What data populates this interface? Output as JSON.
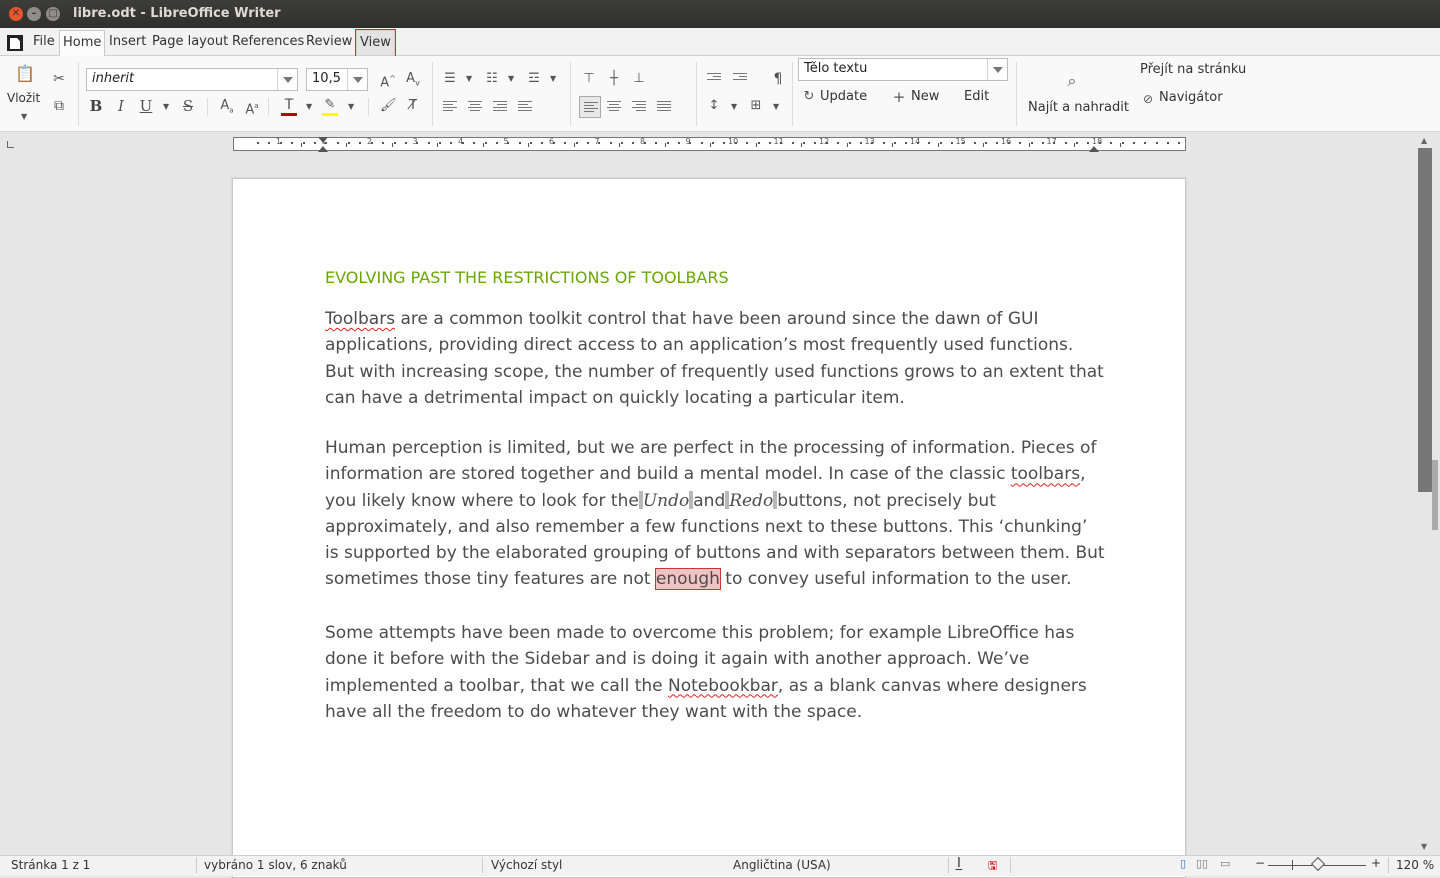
{
  "window": {
    "title": "libre.odt - LibreOffice Writer"
  },
  "tabs": [
    "File",
    "Home",
    "Insert",
    "Page layout",
    "References",
    "Review",
    "View"
  ],
  "ribbon": {
    "paste_label": "Vložit",
    "font_name": "inherit",
    "font_size": "10,5",
    "para_style": "Tělo textu",
    "update_label": "Update",
    "new_label": "New",
    "edit_label": "Edit",
    "find_replace_label": "Najít a nahradit",
    "goto_page_label": "Přejít na stránku",
    "navigator_label": "Navigátor",
    "font_color": "#c00000",
    "highlight_color": "#ffff00"
  },
  "ruler": {
    "numbers": [
      "1",
      "1",
      "2",
      "3",
      "4",
      "5",
      "6",
      "7",
      "8",
      "9",
      "10",
      "11",
      "12",
      "13",
      "14",
      "15",
      "16",
      "17",
      "18"
    ]
  },
  "document": {
    "heading": "EVOLVING PAST THE RESTRICTIONS OF TOOLBARS",
    "p1": {
      "w_toolbars": "Toolbars",
      "l1": " are a common toolkit control that have been around since the dawn of GUI",
      "l2": "applications, providing direct access to an application’s most frequently used functions.",
      "l3": "But with increasing scope, the number of frequently used functions grows to an extent that",
      "l4": "can have a detrimental impact on quickly locating a particular item."
    },
    "p2": {
      "l1": "Human perception is limited, but we are perfect in the processing of information. Pieces of",
      "l2a": "information are stored together and build a mental model. In case of the classic ",
      "w_toolbars": "toolbars",
      "l2b": ",",
      "l3a": "you likely know where to look for the",
      "undo": "Undo",
      "and": "and",
      "redo": "Redo",
      "l3b": "buttons, not precisely but",
      "l4": "approximately, and also remember a few functions next to these buttons. This ‘chunking’",
      "l5": "is supported by the elaborated grouping of buttons and with separators between them. But",
      "l6a": "sometimes those tiny features are not ",
      "selected": "enough",
      "l6b": " to convey useful information to the user."
    },
    "p3": {
      "l1": "Some attempts have been made to overcome this problem; for example LibreOffice has",
      "l2": "done it before with the Sidebar and is doing it again with another approach. We’ve",
      "l3a": "implemented a toolbar, that we call the ",
      "w_notebookbar": "Notebookbar",
      "l3b": ", as a blank canvas where designers",
      "l4": "have all the freedom to do whatever they want with the space."
    },
    "heading_color": "#6aa600"
  },
  "statusbar": {
    "page": "Stránka 1 z 1",
    "selection": "vybráno 1 slov, 6 znaků",
    "page_style": "Výchozí styl",
    "language": "Angličtina (USA)",
    "zoom": "120 %"
  }
}
